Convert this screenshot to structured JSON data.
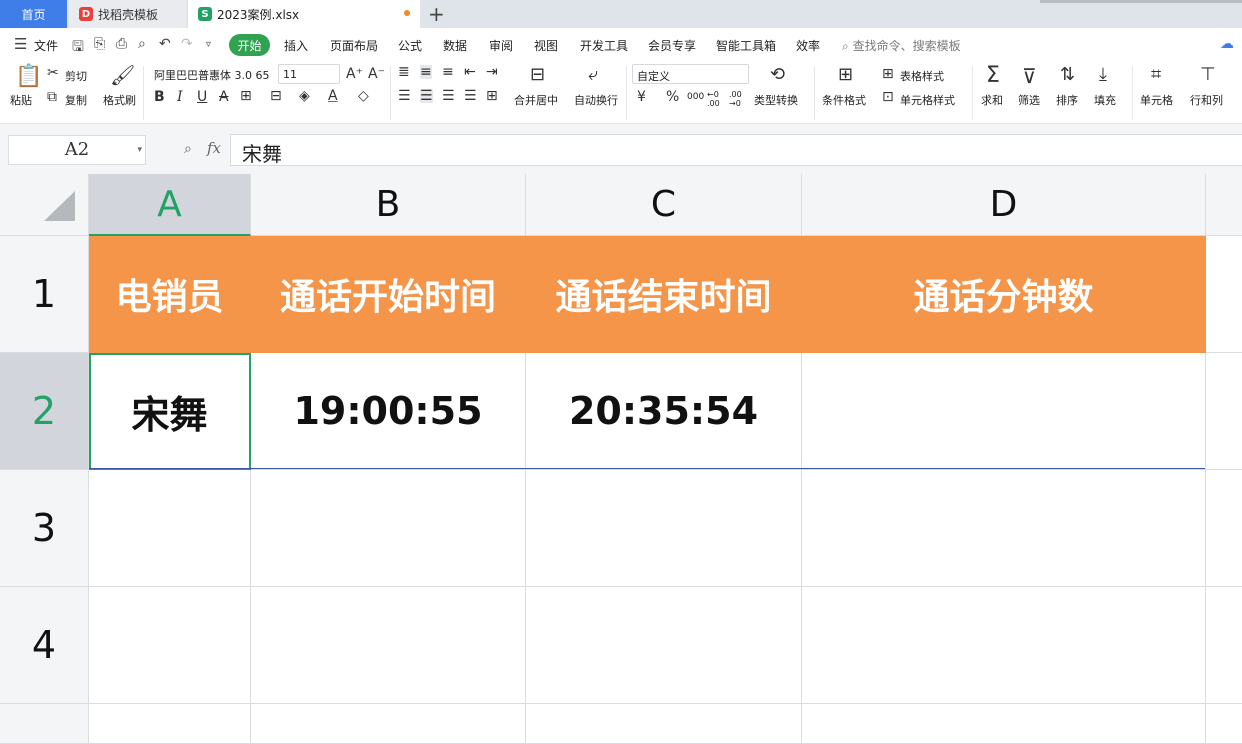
{
  "tabs": {
    "home": "首页",
    "template": "找稻壳模板",
    "file": "2023案例.xlsx",
    "file_icon": "S",
    "template_icon": "D",
    "add": "+"
  },
  "menu": {
    "file": "文件",
    "items": [
      "开始",
      "插入",
      "页面布局",
      "公式",
      "数据",
      "审阅",
      "视图",
      "开发工具",
      "会员专享",
      "智能工具箱",
      "效率"
    ],
    "search_placeholder": "查找命令、搜索模板"
  },
  "ribbon": {
    "paste": "粘贴",
    "cut": "剪切",
    "copy": "复制",
    "format_painter": "格式刷",
    "font_name": "阿里巴巴普惠体 3.0 65",
    "font_size": "11",
    "merge_center": "合并居中",
    "wrap_text": "自动换行",
    "number_format": "自定义",
    "convert_type": "类型转换",
    "conditional_format": "条件格式",
    "table_style": "表格样式",
    "cell_style": "单元格样式",
    "sum": "求和",
    "filter": "筛选",
    "sort": "排序",
    "fill": "填充",
    "cell": "单元格",
    "row_col": "行和列",
    "currency": "¥",
    "percent": "%",
    "thousands": "000",
    "dec_inc": "←0 .00",
    "dec_dec": ".00 →0"
  },
  "formula_bar": {
    "name_box": "A2",
    "fx": "fx",
    "content": "宋舞"
  },
  "sheet": {
    "columns": [
      "A",
      "B",
      "C",
      "D"
    ],
    "rows": [
      "1",
      "2",
      "3",
      "4"
    ],
    "header_row": [
      "电销员",
      "通话开始时间",
      "通话结束时间",
      "通话分钟数"
    ],
    "data_row": [
      "宋舞",
      "19:00:55",
      "20:35:54",
      ""
    ]
  },
  "colors": {
    "accent_green": "#21a366",
    "header_fill": "#f5954a",
    "home_tab": "#3f7ee8",
    "active_menu": "#2fa34f"
  }
}
